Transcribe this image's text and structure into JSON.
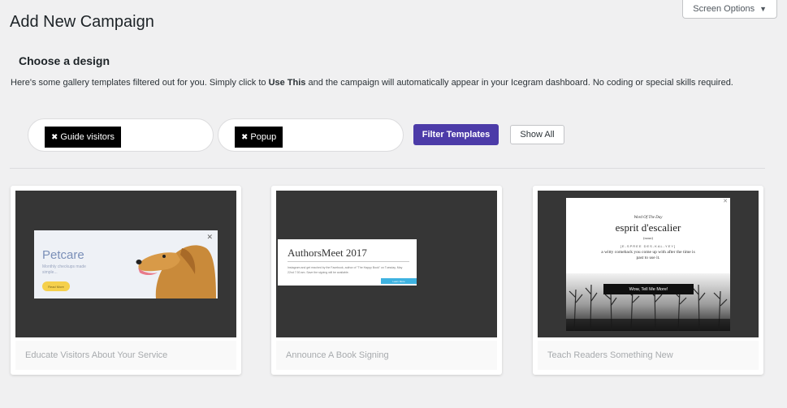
{
  "screen_options": {
    "label": "Screen Options",
    "icon": "caret-down-icon"
  },
  "page": {
    "title": "Add New Campaign",
    "section_title": "Choose a design",
    "description_pre": "Here's some gallery templates filtered out for you. Simply click to ",
    "description_bold": "Use This",
    "description_post": " and the campaign will automatically appear in your Icegram dashboard. No coding or special skills required."
  },
  "filters": {
    "goal_chip": "Guide visitors",
    "type_chip": "Popup",
    "chip_remove_icon": "close-icon",
    "filter_button": "Filter Templates",
    "show_all_button": "Show All"
  },
  "templates": [
    {
      "label": "Educate Visitors About Your Service",
      "preview": {
        "title": "Petcare",
        "subtitle": "Monthly checkups made simple...",
        "button": "Read More"
      }
    },
    {
      "label": "Announce A Book Signing",
      "preview": {
        "title": "AuthorsMeet 2017",
        "body": "Instagram and get reached by the Facebook, author of \"The Happy Book\" on Tuesday, May 22nd 7:30 am. Save the signing will be available.",
        "button": "Learn More"
      }
    },
    {
      "label": "Teach Readers Something New",
      "preview": {
        "kicker": "Word Of The Day",
        "title": "esprit d'escalier",
        "pos": "(noun)",
        "phonetic": "[E-SPREE DES-KAL-YEY]",
        "definition": "a witty comeback you come up with after the time is past to use it.",
        "button": "Wow, Tell Me More!"
      }
    }
  ],
  "colors": {
    "background": "#f0f0f1",
    "primary_button": "#4c3ba8",
    "preview_bg": "#363636",
    "petcare_button": "#f5d04c",
    "authors_bar": "#3eb2e0"
  }
}
